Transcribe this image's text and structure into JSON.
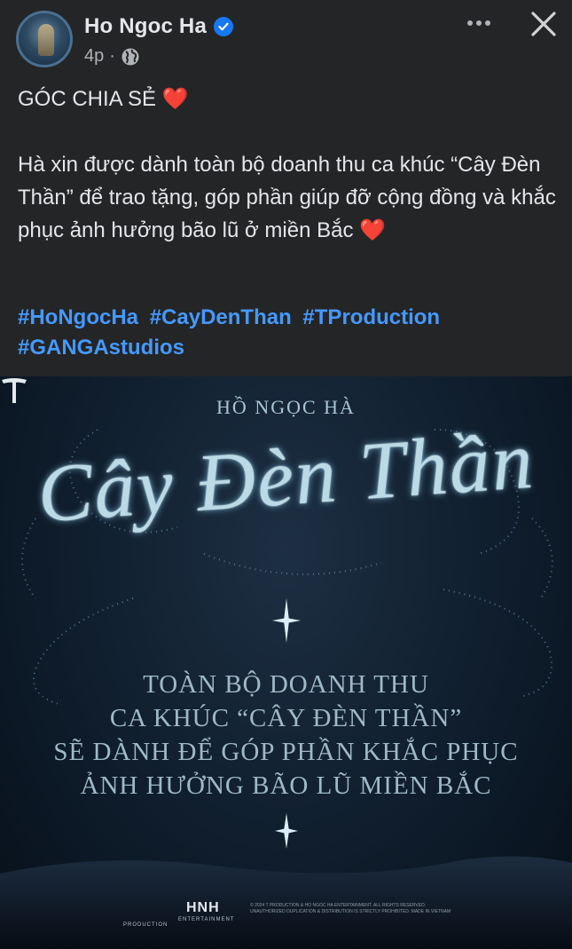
{
  "post": {
    "author": "Ho Ngoc Ha",
    "time": "4p",
    "separator": "·",
    "heading": "GÓC CHIA SẺ ❤️",
    "body": "Hà xin được dành toàn bộ doanh thu ca khúc “Cây Đèn Thần” để trao tặng, góp phần giúp đỡ cộng đồng và khắc phục ảnh hưởng bão lũ ở miền Bắc ❤️",
    "hashtags": [
      "#HoNgocHa",
      "#CayDenThan",
      "#TProduction",
      "#GANGAstudios"
    ]
  },
  "icons": {
    "verified": "verified-badge-icon",
    "audience": "globe-icon",
    "more": "more-options-icon",
    "close": "close-icon"
  },
  "poster": {
    "artist": "HỒ NGỌC HÀ",
    "title": "Cây Đèn Thần",
    "message_lines": [
      "TOÀN BỘ DOANH THU",
      "CA KHÚC “CÂY ĐÈN THẦN”",
      "SẼ DÀNH ĐỂ GÓP PHẦN KHẮC PHỤC",
      "ẢNH HƯỞNG BÃO LŨ MIỀN BẮC"
    ],
    "logo_t_label": "PRODUCTION",
    "logo_hnh": "HNH",
    "logo_hnh_sub": "ENTERTAINMENT",
    "copyright_lines": [
      "© 2024 T PRODUCTION & HO NGOC HA ENTERTAINMENT. ALL RIGHTS RESERVED.",
      "UNAUTHORIZED DUPLICATION & DISTRIBUTION IS STRICTLY PROHIBITED. MADE IN VIETNAM"
    ]
  },
  "colors": {
    "background": "#242526",
    "text": "#e4e6eb",
    "secondary": "#b0b3b8",
    "hashtag": "#4599ff",
    "verified": "#1877f2"
  }
}
